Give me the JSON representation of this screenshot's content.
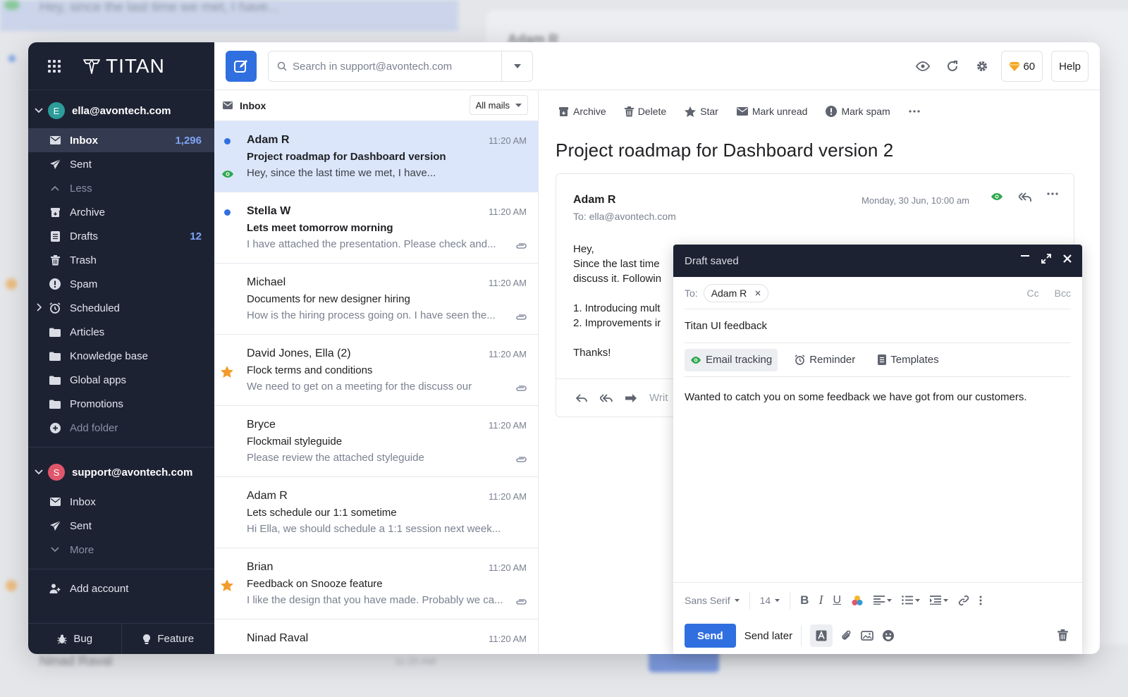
{
  "background": {
    "preview": "Hey, since the last time we met, I have...",
    "sender": "Adam R",
    "row_name": "Ninad Raval",
    "row_time": "11:20 AM"
  },
  "brand": {
    "name": "TITAN"
  },
  "accounts": [
    {
      "email": "ella@avontech.com",
      "initial": "E",
      "color": "#2b9c9a",
      "items": [
        {
          "label": "Inbox",
          "icon": "envelope-icon",
          "count": "1,296",
          "active": true
        },
        {
          "label": "Sent",
          "icon": "send-icon"
        },
        {
          "label": "Less",
          "icon": "chevron-up-icon",
          "dim": true
        },
        {
          "label": "Archive",
          "icon": "archive-icon"
        },
        {
          "label": "Drafts",
          "icon": "drafts-icon",
          "count": "12"
        },
        {
          "label": "Trash",
          "icon": "trash-icon"
        },
        {
          "label": "Spam",
          "icon": "spam-icon"
        },
        {
          "label": "Scheduled",
          "icon": "alarm-icon",
          "expandable": true
        },
        {
          "label": "Articles",
          "icon": "folder-icon"
        },
        {
          "label": "Knowledge base",
          "icon": "folder-icon"
        },
        {
          "label": "Global apps",
          "icon": "folder-icon"
        },
        {
          "label": "Promotions",
          "icon": "folder-icon"
        },
        {
          "label": "Add folder",
          "icon": "add-folder-icon",
          "dim": true
        }
      ]
    },
    {
      "email": "support@avontech.com",
      "initial": "S",
      "color": "#e0566b",
      "items": [
        {
          "label": "Inbox",
          "icon": "envelope-icon"
        },
        {
          "label": "Sent",
          "icon": "send-icon"
        },
        {
          "label": "More",
          "icon": "chevron-down-icon",
          "dim": true
        }
      ]
    }
  ],
  "add_account": "Add account",
  "footer": {
    "bug": "Bug",
    "feature": "Feature"
  },
  "search": {
    "placeholder": "Search in support@avontech.com"
  },
  "credits": "60",
  "help": "Help",
  "list": {
    "folder": "Inbox",
    "filter": "All mails",
    "mails": [
      {
        "from": "Adam R",
        "subject": "Project roadmap for Dashboard version",
        "preview": "Hey, since the last time we met, I have...",
        "time": "11:20 AM",
        "unread": true,
        "selected": true,
        "tracked": true
      },
      {
        "from": "Stella W",
        "subject": "Lets meet tomorrow morning",
        "preview": "I have attached the presentation. Please check and...",
        "time": "11:20 AM",
        "unread": true,
        "attachment": true
      },
      {
        "from": "Michael",
        "subject": "Documents for new designer hiring",
        "preview": "How is the hiring process going on. I have seen the...",
        "time": "11:20 AM",
        "attachment": true
      },
      {
        "from": "David Jones, Ella (2)",
        "subject": "Flock terms and conditions",
        "preview": "We need to get on a meeting for the discuss our",
        "time": "11:20 AM",
        "starred": true,
        "attachment": true
      },
      {
        "from": "Bryce",
        "subject": "Flockmail styleguide",
        "preview": "Please review the attached styleguide",
        "time": "11:20 AM",
        "attachment": true
      },
      {
        "from": "Adam R",
        "subject": "Lets schedule our 1:1 sometime",
        "preview": "Hi Ella, we should schedule a 1:1 session next week...",
        "time": "11:20 AM"
      },
      {
        "from": "Brian",
        "subject": "Feedback on Snooze feature",
        "preview": "I like the design that you have made. Probably we ca...",
        "time": "11:20 AM",
        "starred": true,
        "attachment": true
      },
      {
        "from": "Ninad Raval",
        "subject": "",
        "preview": "",
        "time": "11:20 AM"
      }
    ]
  },
  "reader": {
    "toolbar": {
      "archive": "Archive",
      "delete": "Delete",
      "star": "Star",
      "mark_unread": "Mark unread",
      "mark_spam": "Mark spam"
    },
    "title": "Project roadmap for Dashboard version 2",
    "from": "Adam R",
    "to": "To: ella@avontech.com",
    "date": "Monday, 30 Jun, 10:00 am",
    "body": {
      "greeting": "Hey,",
      "line1": "Since the last time",
      "line2": "discuss it. Followin",
      "item1": "1. Introducing mult",
      "item2": "2. Improvements ir",
      "thanks": "Thanks!"
    },
    "reply_placeholder": "Writ"
  },
  "compose": {
    "status": "Draft saved",
    "to_label": "To:",
    "recipient": "Adam R",
    "cc": "Cc",
    "bcc": "Bcc",
    "subject": "Titan UI feedback",
    "options": {
      "tracking": "Email tracking",
      "reminder": "Reminder",
      "templates": "Templates"
    },
    "body": "Wanted to catch you on some feedback we have got from our customers.",
    "font": "Sans Serif",
    "size": "14",
    "send": "Send",
    "send_later": "Send later"
  }
}
